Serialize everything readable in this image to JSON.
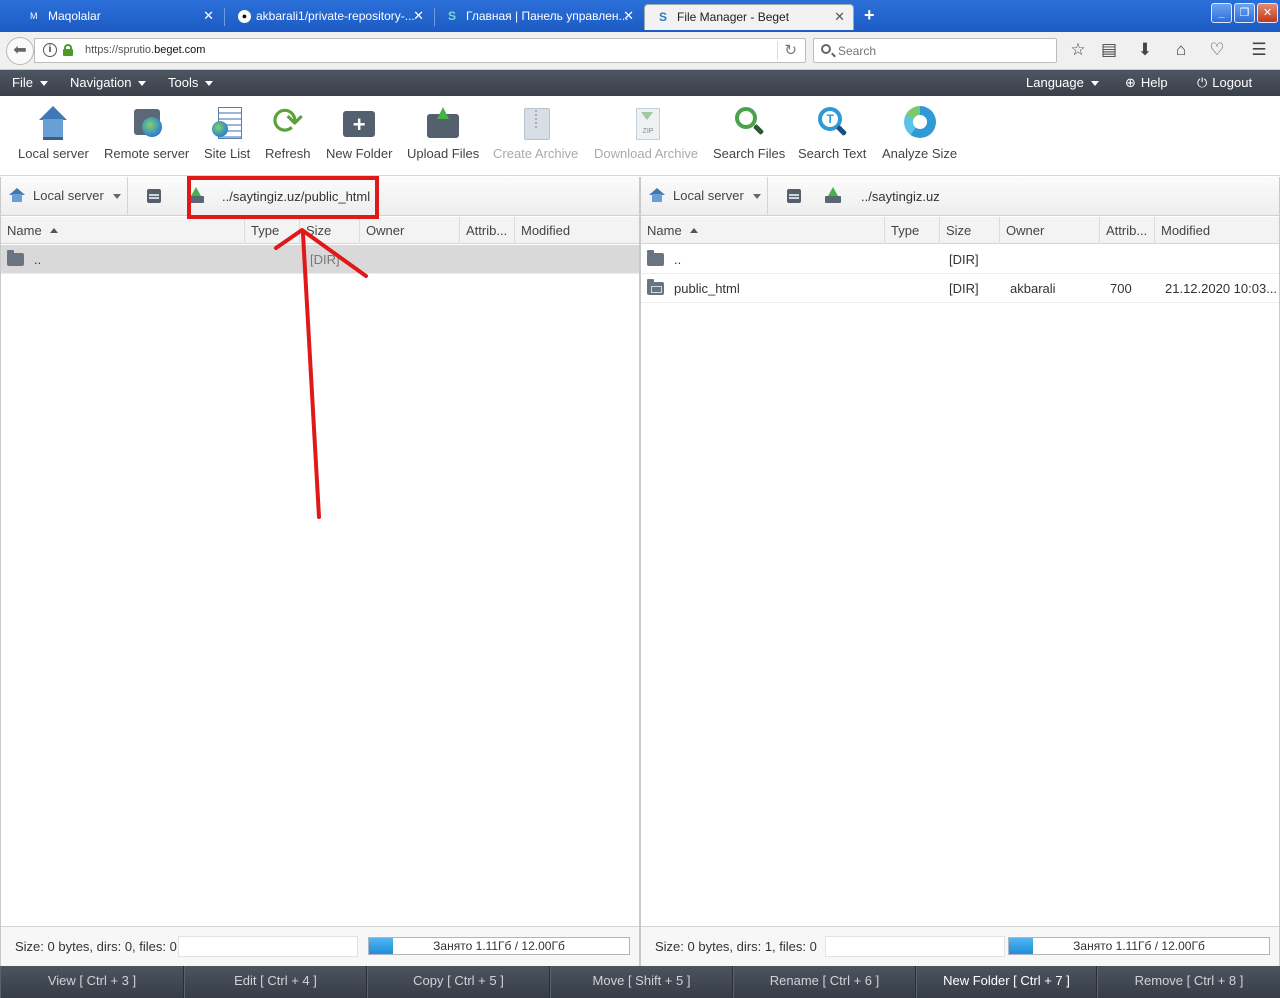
{
  "browser": {
    "tabs": [
      {
        "title": "Maqolalar",
        "favicon": "M"
      },
      {
        "title": "akbarali1/private-repository-...",
        "favicon": "github-icon"
      },
      {
        "title": "Главная | Панель управлен...",
        "favicon": "S"
      },
      {
        "title": "File Manager - Beget",
        "favicon": "S"
      }
    ],
    "url_prefix": "https://sprutio.",
    "url_host": "beget.com",
    "search_placeholder": "Search"
  },
  "menu": {
    "left": [
      "File",
      "Navigation",
      "Tools"
    ],
    "language": "Language",
    "help": "Help",
    "logout": "Logout"
  },
  "toolbar": [
    {
      "label": "Local server",
      "icon": "home-icon",
      "disabled": false
    },
    {
      "label": "Remote server",
      "icon": "remote-server-icon",
      "disabled": false
    },
    {
      "label": "Site List",
      "icon": "site-list-icon",
      "disabled": false
    },
    {
      "label": "Refresh",
      "icon": "refresh-icon",
      "disabled": false
    },
    {
      "label": "New Folder",
      "icon": "new-folder-icon",
      "disabled": false
    },
    {
      "label": "Upload Files",
      "icon": "upload-icon",
      "disabled": false
    },
    {
      "label": "Create Archive",
      "icon": "archive-icon",
      "disabled": true
    },
    {
      "label": "Download Archive",
      "icon": "download-archive-icon",
      "disabled": true
    },
    {
      "label": "Search Files",
      "icon": "search-files-icon",
      "disabled": false
    },
    {
      "label": "Search Text",
      "icon": "search-text-icon",
      "disabled": false
    },
    {
      "label": "Analyze Size",
      "icon": "analyze-size-icon",
      "disabled": false
    }
  ],
  "columns": [
    "Name",
    "Type",
    "Size",
    "Owner",
    "Attrib...",
    "Modified"
  ],
  "left_panel": {
    "server": "Local server",
    "path": "../saytingiz.uz/public_html",
    "rows": [
      {
        "name": "..",
        "type": "",
        "size": "[DIR]",
        "owner": "",
        "attrib": "",
        "modified": ""
      }
    ],
    "status": "Size: 0 bytes, dirs: 0, files: 0",
    "quota": "Занято 1.11Гб / 12.00Гб",
    "quota_fraction": 0.0925
  },
  "right_panel": {
    "server": "Local server",
    "path": "../saytingiz.uz",
    "rows": [
      {
        "name": "..",
        "type": "",
        "size": "[DIR]",
        "owner": "",
        "attrib": "",
        "modified": ""
      },
      {
        "name": "public_html",
        "type": "",
        "size": "[DIR]",
        "owner": "akbarali",
        "attrib": "700",
        "modified": "21.12.2020 10:03..."
      }
    ],
    "status": "Size: 0 bytes, dirs: 1, files: 0",
    "quota": "Занято 1.11Гб / 12.00Гб",
    "quota_fraction": 0.0925
  },
  "function_bar": [
    "View [ Ctrl + 3 ]",
    "Edit [ Ctrl + 4 ]",
    "Copy [ Ctrl + 5 ]",
    "Move [ Shift + 5 ]",
    "Rename [ Ctrl + 6 ]",
    "New Folder [ Ctrl + 7 ]",
    "Remove [ Ctrl + 8 ]"
  ],
  "colors": {
    "accent": "#1d8fdc",
    "annotation": "#e01818",
    "menubar": "#3a4049"
  }
}
